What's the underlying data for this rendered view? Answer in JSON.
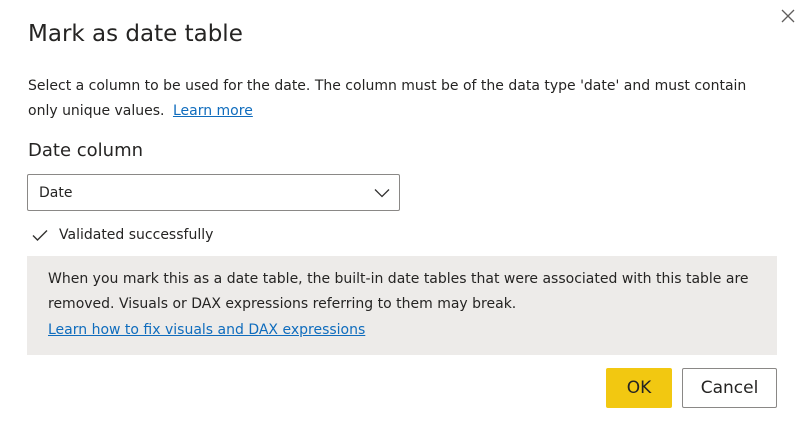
{
  "dialog": {
    "title": "Mark as date table",
    "description": "Select a column to be used for the date. The column must be of the data type 'date' and must contain only unique values.",
    "learn_more_label": "Learn more",
    "date_column_label": "Date column",
    "date_column_value": "Date",
    "validation_text": "Validated successfully",
    "info_text": "When you mark this as a date table, the built-in date tables that were associated with this table are removed. Visuals or DAX expressions referring to them may break.",
    "info_link_label": "Learn how to fix visuals and DAX expressions",
    "ok_label": "OK",
    "cancel_label": "Cancel"
  },
  "icons": {
    "close": "close-icon",
    "chevron": "chevron-down-icon",
    "check": "checkmark-icon"
  },
  "colors": {
    "primary_button": "#f2c811",
    "link": "#0f6cbd",
    "info_background": "#edebe9",
    "border": "#8a8886",
    "text": "#252423"
  }
}
